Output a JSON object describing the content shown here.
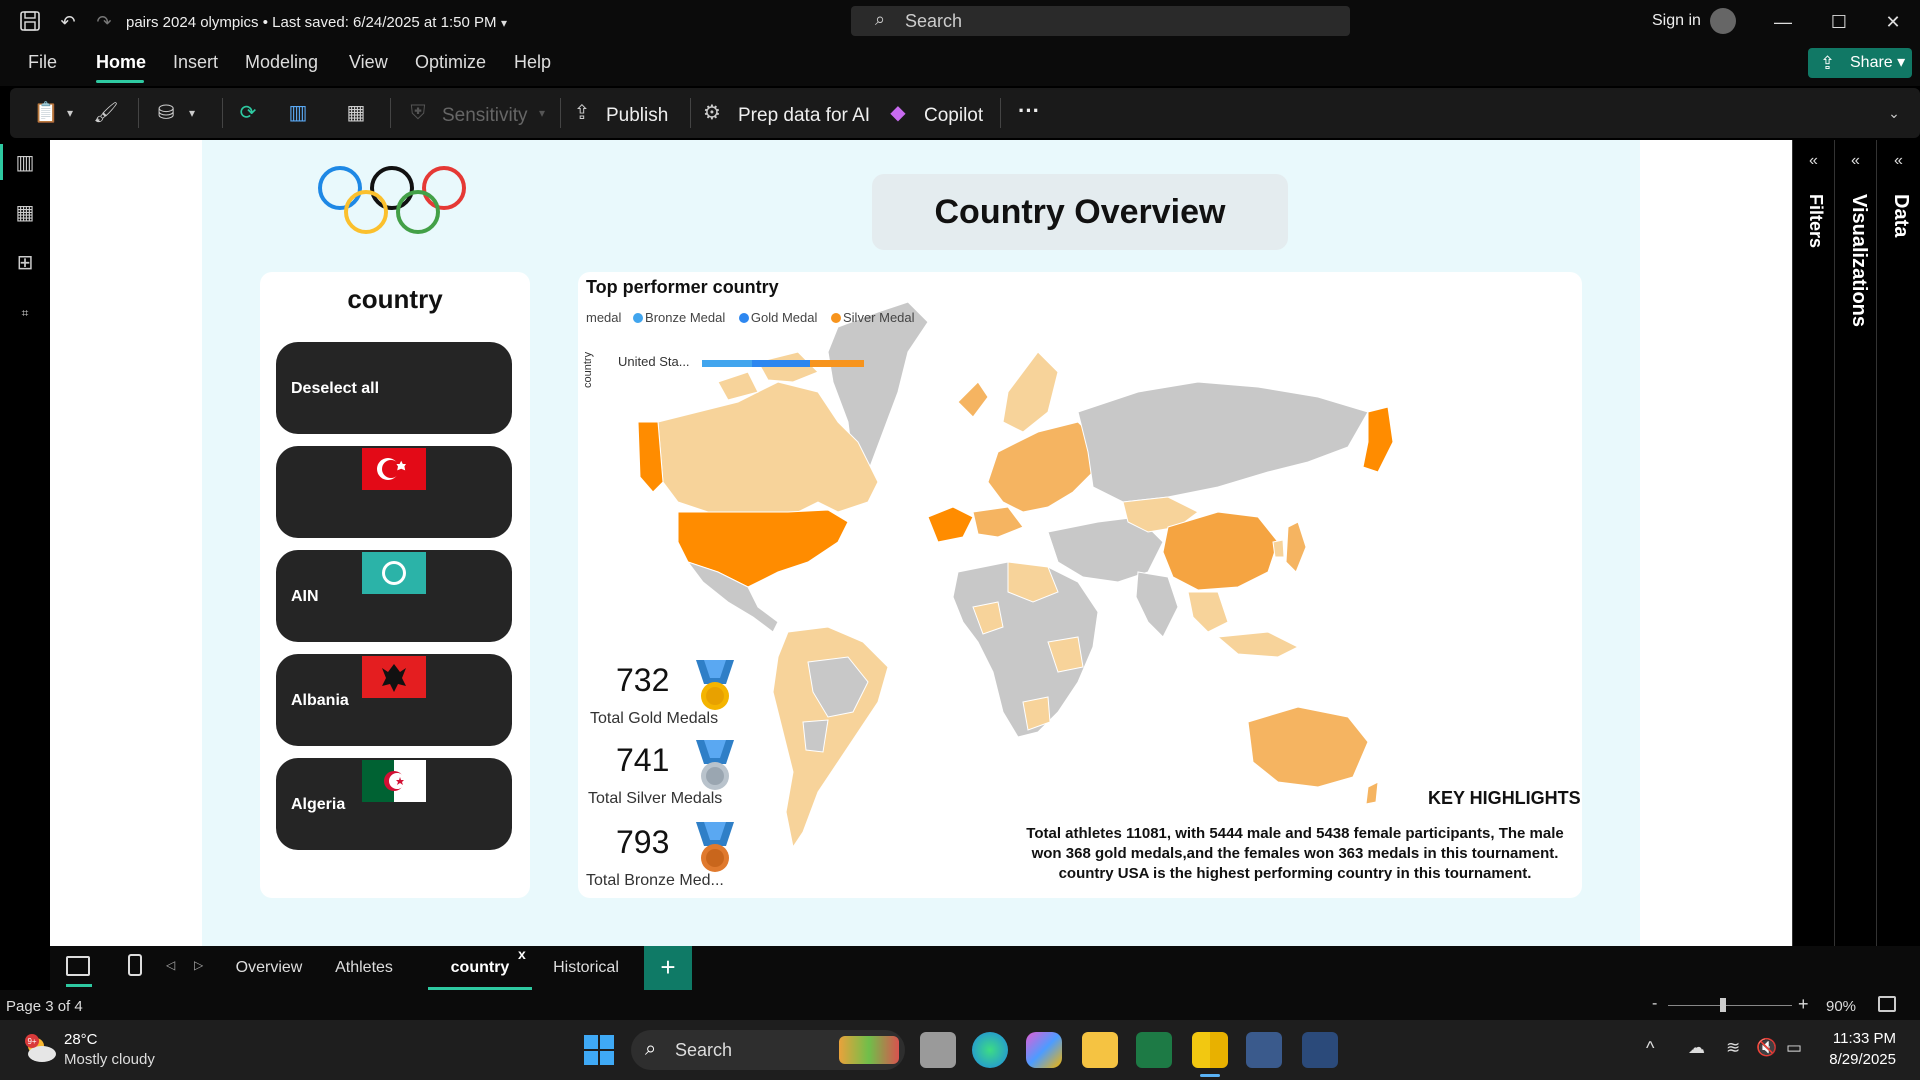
{
  "titlebar": {
    "doc_title": "pairs 2024 olympics • Last saved: 6/24/2025 at 1:50 PM",
    "search_placeholder": "Search",
    "sign_in": "Sign in"
  },
  "menu": {
    "items": [
      "File",
      "Home",
      "Insert",
      "Modeling",
      "View",
      "Optimize",
      "Help"
    ],
    "active": "Home",
    "share": "Share"
  },
  "ribbon": {
    "sensitivity": "Sensitivity",
    "publish": "Publish",
    "prep_data": "Prep data for AI",
    "copilot": "Copilot",
    "more": "···"
  },
  "report": {
    "title": "Country Overview",
    "slicer": {
      "title": "country",
      "items": [
        {
          "label": "Deselect all",
          "flag": ""
        },
        {
          "label": "",
          "flag": "turkey-flag"
        },
        {
          "label": "AIN",
          "flag": "ain-flag"
        },
        {
          "label": "Albania",
          "flag": "albania-flag"
        },
        {
          "label": "Algeria",
          "flag": "algeria-flag"
        }
      ]
    },
    "map": {
      "title": "Top performer country",
      "legend_title": "medal",
      "legend": [
        {
          "name": "Bronze Medal",
          "color": "#41a5ee"
        },
        {
          "name": "Gold Medal",
          "color": "#2d87f0"
        },
        {
          "name": "Silver Medal",
          "color": "#f7941d"
        }
      ],
      "axis_title": "country",
      "bar_label": "United Sta...",
      "highest_color": "#ff8c00",
      "high_color": "#f5b461",
      "low_color": "#f7d39a",
      "none_color": "#c8c8c8"
    },
    "kpis": [
      {
        "value": "732",
        "label": "Total Gold Medals",
        "medal": "gold-medal"
      },
      {
        "value": "741",
        "label": "Total Silver Medals",
        "medal": "silver-medal"
      },
      {
        "value": "793",
        "label": "Total Bronze Med...",
        "medal": "bronze-medal"
      }
    ],
    "key_highlights": {
      "title": "KEY HIGHLIGHTS",
      "text": "Total athletes 11081, with 5444 male and 5438 female participants, The male won 368 gold medals,and the females won 363 medals in this tournament. country USA is the highest performing country in this tournament."
    }
  },
  "panes": {
    "filters": "Filters",
    "visualizations": "Visualizations",
    "data": "Data"
  },
  "pages": {
    "tabs": [
      "Overview",
      "Athletes",
      "country",
      "Historical"
    ],
    "active": "country",
    "close": "x",
    "add": "+"
  },
  "status": {
    "page": "Page 3 of 4",
    "zoom": "90%",
    "zoom_fraction": 0.45
  },
  "taskbar": {
    "weather_temp": "28°C",
    "weather_desc": "Mostly cloudy",
    "weather_badge": "9+",
    "search": "Search",
    "time": "11:33 PM",
    "date": "8/29/2025"
  }
}
